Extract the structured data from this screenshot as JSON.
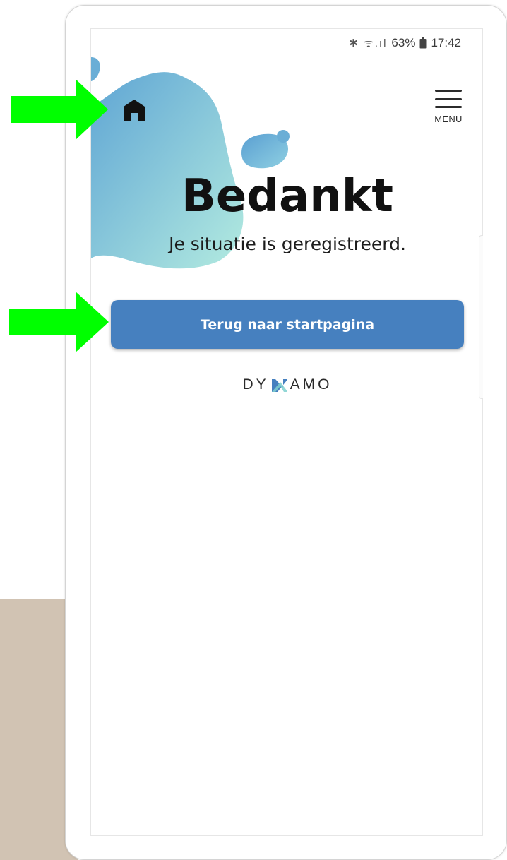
{
  "status_bar": {
    "icons": "✱ ᯤ.ıl",
    "battery": "63%",
    "time": "17:42"
  },
  "header": {
    "menu_label": "MENU"
  },
  "main": {
    "title": "Bedankt",
    "subtitle": "Je situatie is geregistreerd.",
    "cta_label": "Terug naar startpagina"
  },
  "brand": {
    "left": "DY",
    "right": "AMO"
  },
  "colors": {
    "button": "#4680bf",
    "blob_top": "#6aaed6",
    "blob_bottom": "#a8e3dc",
    "arrow": "#00ff00",
    "background_block": "#d1c3b3"
  }
}
